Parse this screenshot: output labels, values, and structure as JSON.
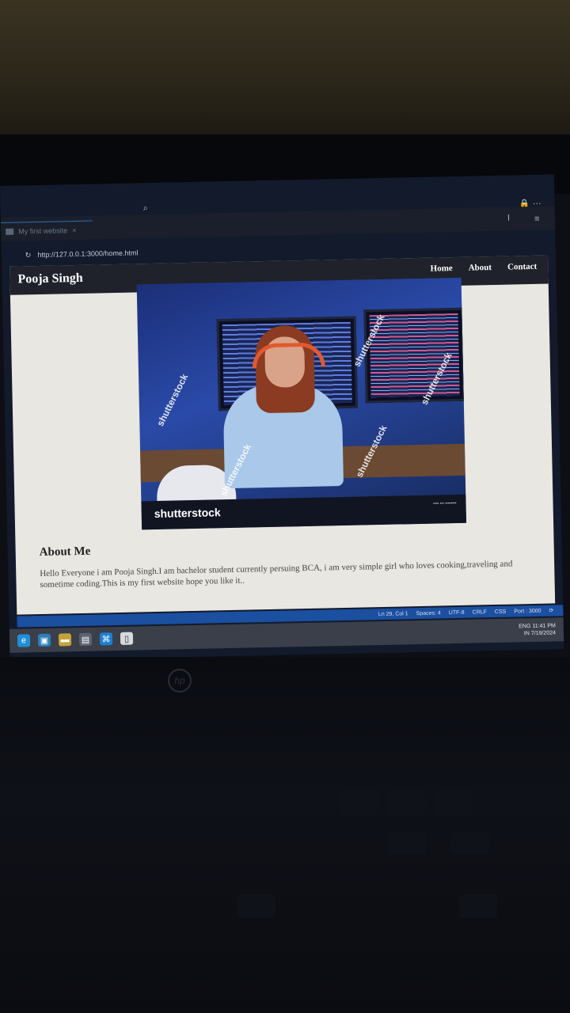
{
  "browser": {
    "tab_title": "My first website",
    "tab_close": "×",
    "url": "http://127.0.0.1:3000/home.html",
    "icons": [
      "search-icon",
      "lock-icon",
      "more-icon",
      "menu-icon",
      "reload-icon",
      "cursor-icon"
    ]
  },
  "site": {
    "brand": "Pooja Singh",
    "nav": [
      "Home",
      "About",
      "Contact"
    ],
    "photo": {
      "watermarks": [
        "shutterstock",
        "shutterstock",
        "shutterstock",
        "shutterstock",
        "shutterstock"
      ],
      "footer_brand": "shutterstock"
    },
    "about": {
      "heading": "About Me",
      "text": "Hello Everyone i am Pooja Singh.I am bachelor student currently persuing BCA, i am very simple girl who loves cooking,traveling and sometime coding.This is my first website hope you like it.."
    }
  },
  "editor_status": {
    "position": "Ln 29, Col 1",
    "spaces": "Spaces: 4",
    "encoding": "UTF-8",
    "eol": "CRLF",
    "language": "CSS",
    "port": "Port : 3000"
  },
  "taskbar": {
    "lang": "ENG",
    "region": "IN",
    "time": "11:41 PM",
    "date": "7/19/2024"
  },
  "laptop": {
    "logo": "hp"
  }
}
